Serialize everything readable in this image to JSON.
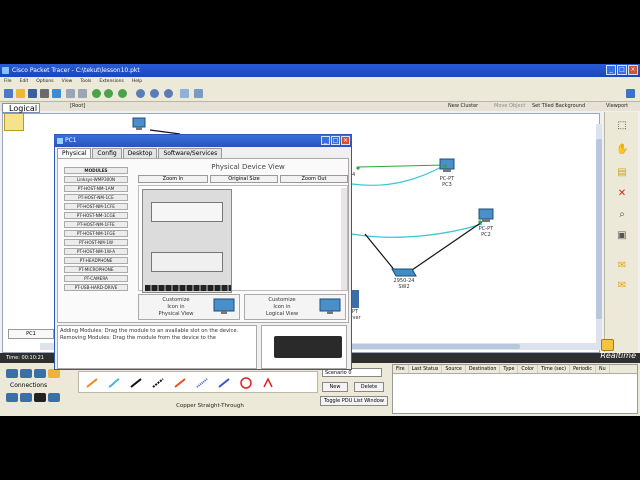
{
  "app": {
    "title": "Cisco Packet Tracer - C:\\tekut\\lesson10.pkt",
    "window_controls": [
      "_",
      "□",
      "×"
    ]
  },
  "menu": [
    "File",
    "Edit",
    "Options",
    "View",
    "Tools",
    "Extensions",
    "Help"
  ],
  "workspace_bar": {
    "root": "[Root]",
    "new_cluster": "New Cluster",
    "move_object": "Move Object",
    "set_tiled_background": "Set Tiled Background",
    "viewport": "Viewport"
  },
  "logical_tab": "Logical",
  "devices": {
    "pc3": [
      "PC-PT",
      "PC3"
    ],
    "pc2": [
      "PC-PT",
      "PC2"
    ],
    "sw2": [
      "2950-24",
      "SW2"
    ],
    "server_partial": [
      "-PT",
      "erver"
    ],
    "sw_partial": "24"
  },
  "pc1_chip": "PC1",
  "status": {
    "time": "Time: 00:10:21",
    "realtime": "Realtime"
  },
  "bottom": {
    "connections_label": "Connections",
    "cable_name": "Copper Straight-Through",
    "scenario": "Scenario 0",
    "new_button": "New",
    "delete_button": "Delete",
    "toggle_pdu": "Toggle PDU List Window",
    "pdu_columns": [
      "Fire",
      "Last Status",
      "Source",
      "Destination",
      "Type",
      "Color",
      "Time (sec)",
      "Periodic",
      "Nu"
    ]
  },
  "dialog": {
    "title": "PC1",
    "tabs": [
      "Physical",
      "Config",
      "Desktop",
      "Software/Services"
    ],
    "active_tab": "Physical",
    "modules": [
      "MODULES",
      "Linksys-WMP300N",
      "PT-HOST-NM-1AM",
      "PT-HOST-NM-1CE",
      "PT-HOST-NM-1CFE",
      "PT-HOST-NM-1CGE",
      "PT-HOST-NM-1FFE",
      "PT-HOST-NM-1FGE",
      "PT-HOST-NM-1W",
      "PT-HOST-NM-1W-A",
      "PT-HEADPHONE",
      "PT-MICROPHONE",
      "PT-CAMERA",
      "PT-USB-HARD-DRIVE"
    ],
    "view_title": "Physical Device View",
    "zoom_in": "Zoom In",
    "original_size": "Original Size",
    "zoom_out": "Zoom Out",
    "customize_physical": "Customize\nIcon in\nPhysical View",
    "customize_logical": "Customize\nIcon in\nLogical View",
    "info_text": "Adding Modules: Drag the module to an available slot on the device.\nRemoving Modules: Drag the module from the device to the"
  },
  "colors": {
    "titlebar": "#2656bd",
    "link_cyan": "#39c7d1",
    "link_black": "#111111"
  }
}
